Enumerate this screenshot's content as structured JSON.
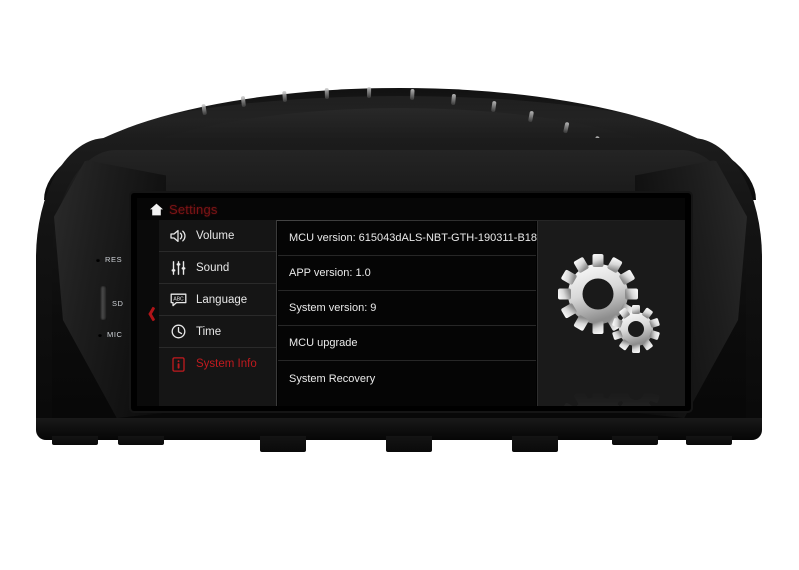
{
  "device": {
    "name": "bmw-android-head-unit",
    "side_controls": [
      {
        "id": "res",
        "label": "RES",
        "type": "reset-pinhole"
      },
      {
        "id": "sd",
        "label": "SD",
        "type": "sd-card-slot"
      },
      {
        "id": "mic",
        "label": "MIC",
        "type": "microphone-pinhole"
      }
    ]
  },
  "screen": {
    "titlebar": {
      "home_icon": "home-icon",
      "title": "Settings",
      "title_color": "#7c1416"
    },
    "back_button": {
      "icon": "chevron-left-icon",
      "color": "#b01418"
    },
    "sidebar": {
      "items": [
        {
          "label": "Volume",
          "icon": "speaker-volume-icon",
          "active": false
        },
        {
          "label": "Sound",
          "icon": "equalizer-sliders-icon",
          "active": false
        },
        {
          "label": "Language",
          "icon": "abc-speech-bubble-icon",
          "active": false
        },
        {
          "label": "Time",
          "icon": "clock-icon",
          "active": false
        },
        {
          "label": "System Info",
          "icon": "info-document-icon",
          "active": true
        }
      ],
      "active_color": "#c01a1e",
      "inactive_color": "#e8e8e8"
    },
    "list": {
      "rows": [
        {
          "label": "MCU version: 615043dALS-NBT-GTH-190311-B18"
        },
        {
          "label": "APP version: 1.0"
        },
        {
          "label": "System version: 9"
        },
        {
          "label": "MCU upgrade"
        },
        {
          "label": "System Recovery"
        }
      ]
    },
    "illustration": {
      "icon": "gears-settings-icon",
      "reflection": true,
      "color": "#dcdcdc"
    },
    "background": "#000000"
  }
}
